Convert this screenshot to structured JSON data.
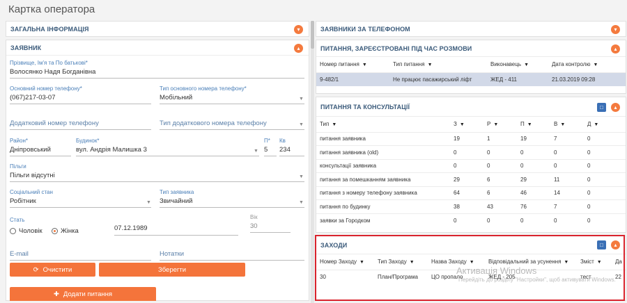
{
  "page": {
    "title": "Картка оператора"
  },
  "left": {
    "general_info": {
      "title": "ЗАГАЛЬНА ІНФОРМАЦІЯ"
    },
    "applicant": {
      "title": "ЗАЯВНИК",
      "full_name": {
        "label": "Прізвище, Ім'я та По батькові*",
        "value": "Волосянко Надя Богданівна"
      },
      "main_phone": {
        "label": "Основний номер телефону*",
        "value": "(067)217-03-07"
      },
      "main_phone_type": {
        "label": "Тип основного номера телефону*",
        "value": "Мобільний"
      },
      "extra_phone": {
        "placeholder": "Додатковий номер телефону"
      },
      "extra_phone_type": {
        "placeholder": "Тип додаткового номера телефону"
      },
      "district": {
        "label": "Район*",
        "value": "Дніпровський"
      },
      "building": {
        "label": "Будинок*",
        "value": "вул. Андрія Малишка 3"
      },
      "entrance": {
        "label": "П*",
        "value": "5"
      },
      "apartment": {
        "label": "Кв",
        "value": "234"
      },
      "benefits": {
        "label": "Пільги",
        "value": "Пільги відсутні"
      },
      "social_status": {
        "label": "Соціальний стан",
        "value": "Робітник"
      },
      "applicant_type": {
        "label": "Тип заявника",
        "value": "Звичайний"
      },
      "sex": {
        "label": "Стать",
        "male": "Чоловік",
        "female": "Жінка"
      },
      "birth_date": {
        "value": "07.12.1989"
      },
      "age": {
        "label": "Вік",
        "value": "30"
      },
      "email": {
        "placeholder": "E-mail"
      },
      "notes": {
        "placeholder": "Нотатки"
      },
      "clear_label": "Очистити",
      "save_label": "Зберегти",
      "add_question_label": "Додати питання"
    }
  },
  "right": {
    "applicants_by_phone": {
      "title": "ЗАЯВНИКИ ЗА ТЕЛЕФОНОМ"
    },
    "questions_registered": {
      "title": "ПИТАННЯ, ЗАРЕЄСТРОВАНІ ПІД ЧАС РОЗМОВИ",
      "columns": [
        "Номер питання",
        "Тип питання",
        "Виконавець",
        "Дата контролю"
      ],
      "rows": [
        [
          "9-482/1",
          "Не працює пасажирський ліфт",
          "ЖЕД - 411",
          "21.03.2019 09:28"
        ]
      ]
    },
    "questions_consultations": {
      "title": "ПИТАННЯ ТА КОНСУЛЬТАЦІЇ",
      "columns": [
        "Тип",
        "З",
        "Р",
        "П",
        "В",
        "Д"
      ],
      "rows": [
        [
          "питання заявника",
          "19",
          "1",
          "19",
          "7",
          "0"
        ],
        [
          "питання заявника (old)",
          "0",
          "0",
          "0",
          "0",
          "0"
        ],
        [
          "консультації заявника",
          "0",
          "0",
          "0",
          "0",
          "0"
        ],
        [
          "питання за помешканням заявника",
          "29",
          "6",
          "29",
          "11",
          "0"
        ],
        [
          "питання з номеру телефону заявника",
          "64",
          "6",
          "46",
          "14",
          "0"
        ],
        [
          "питання по будинку",
          "38",
          "43",
          "76",
          "7",
          "0"
        ],
        [
          "заявки за Городком",
          "0",
          "0",
          "0",
          "0",
          "0"
        ]
      ]
    },
    "measures": {
      "title": "ЗАХОДИ",
      "columns": [
        "Номер Заходу",
        "Тип Заходу",
        "Назва Заходу",
        "Відповідальний за усунення",
        "Зміст",
        "Да"
      ],
      "rows": [
        [
          "30",
          "План/Програма",
          "ЦО пропало",
          "ЖЕД - 205",
          "тест",
          "22"
        ]
      ]
    }
  },
  "watermark": {
    "line1": "Активація Windows",
    "line2": "Перейдіть до розділу \"Настройки\", щоб активувати Windows."
  }
}
